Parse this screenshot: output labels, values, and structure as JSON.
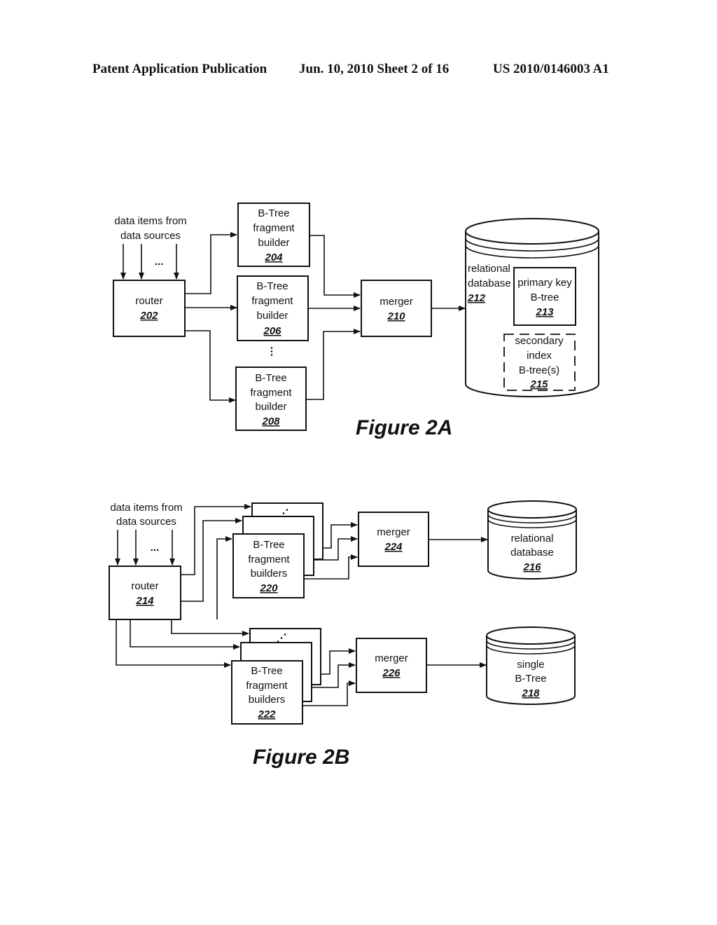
{
  "header": {
    "publication": "Patent Application Publication",
    "date_sheet": "Jun. 10, 2010  Sheet 2 of 16",
    "number": "US 2010/0146003 A1"
  },
  "fig2a": {
    "title": "Figure 2A",
    "input_label": [
      "data items from",
      "data sources"
    ],
    "ellipsis": "...",
    "router": {
      "label": "router",
      "ref": "202"
    },
    "builders": [
      {
        "lines": [
          "B-Tree",
          "fragment",
          "builder"
        ],
        "ref": "204"
      },
      {
        "lines": [
          "B-Tree",
          "fragment",
          "builder"
        ],
        "ref": "206"
      },
      {
        "lines": [
          "B-Tree",
          "fragment",
          "builder"
        ],
        "ref": "208"
      }
    ],
    "vellipsis": "⋮",
    "merger": {
      "label": "merger",
      "ref": "210"
    },
    "database": {
      "lines": [
        "relational",
        "database"
      ],
      "ref": "212"
    },
    "primary_key": {
      "lines": [
        "primary key",
        "B-tree"
      ],
      "ref": "213"
    },
    "secondary": {
      "lines": [
        "secondary",
        "index",
        "B-tree(s)"
      ],
      "ref": "215"
    }
  },
  "fig2b": {
    "title": "Figure 2B",
    "input_label": [
      "data items from",
      "data sources"
    ],
    "ellipsis": "...",
    "router": {
      "label": "router",
      "ref": "214"
    },
    "builders_top": {
      "lines": [
        "B-Tree",
        "fragment",
        "builders"
      ],
      "ref": "220"
    },
    "builders_bottom": {
      "lines": [
        "B-Tree",
        "fragment",
        "builders"
      ],
      "ref": "222"
    },
    "stack_ellipsis": "⋰",
    "merger_top": {
      "label": "merger",
      "ref": "224"
    },
    "merger_bottom": {
      "label": "merger",
      "ref": "226"
    },
    "db_top": {
      "lines": [
        "relational",
        "database"
      ],
      "ref": "216"
    },
    "db_bottom": {
      "lines": [
        "single",
        "B-Tree"
      ],
      "ref": "218"
    }
  }
}
